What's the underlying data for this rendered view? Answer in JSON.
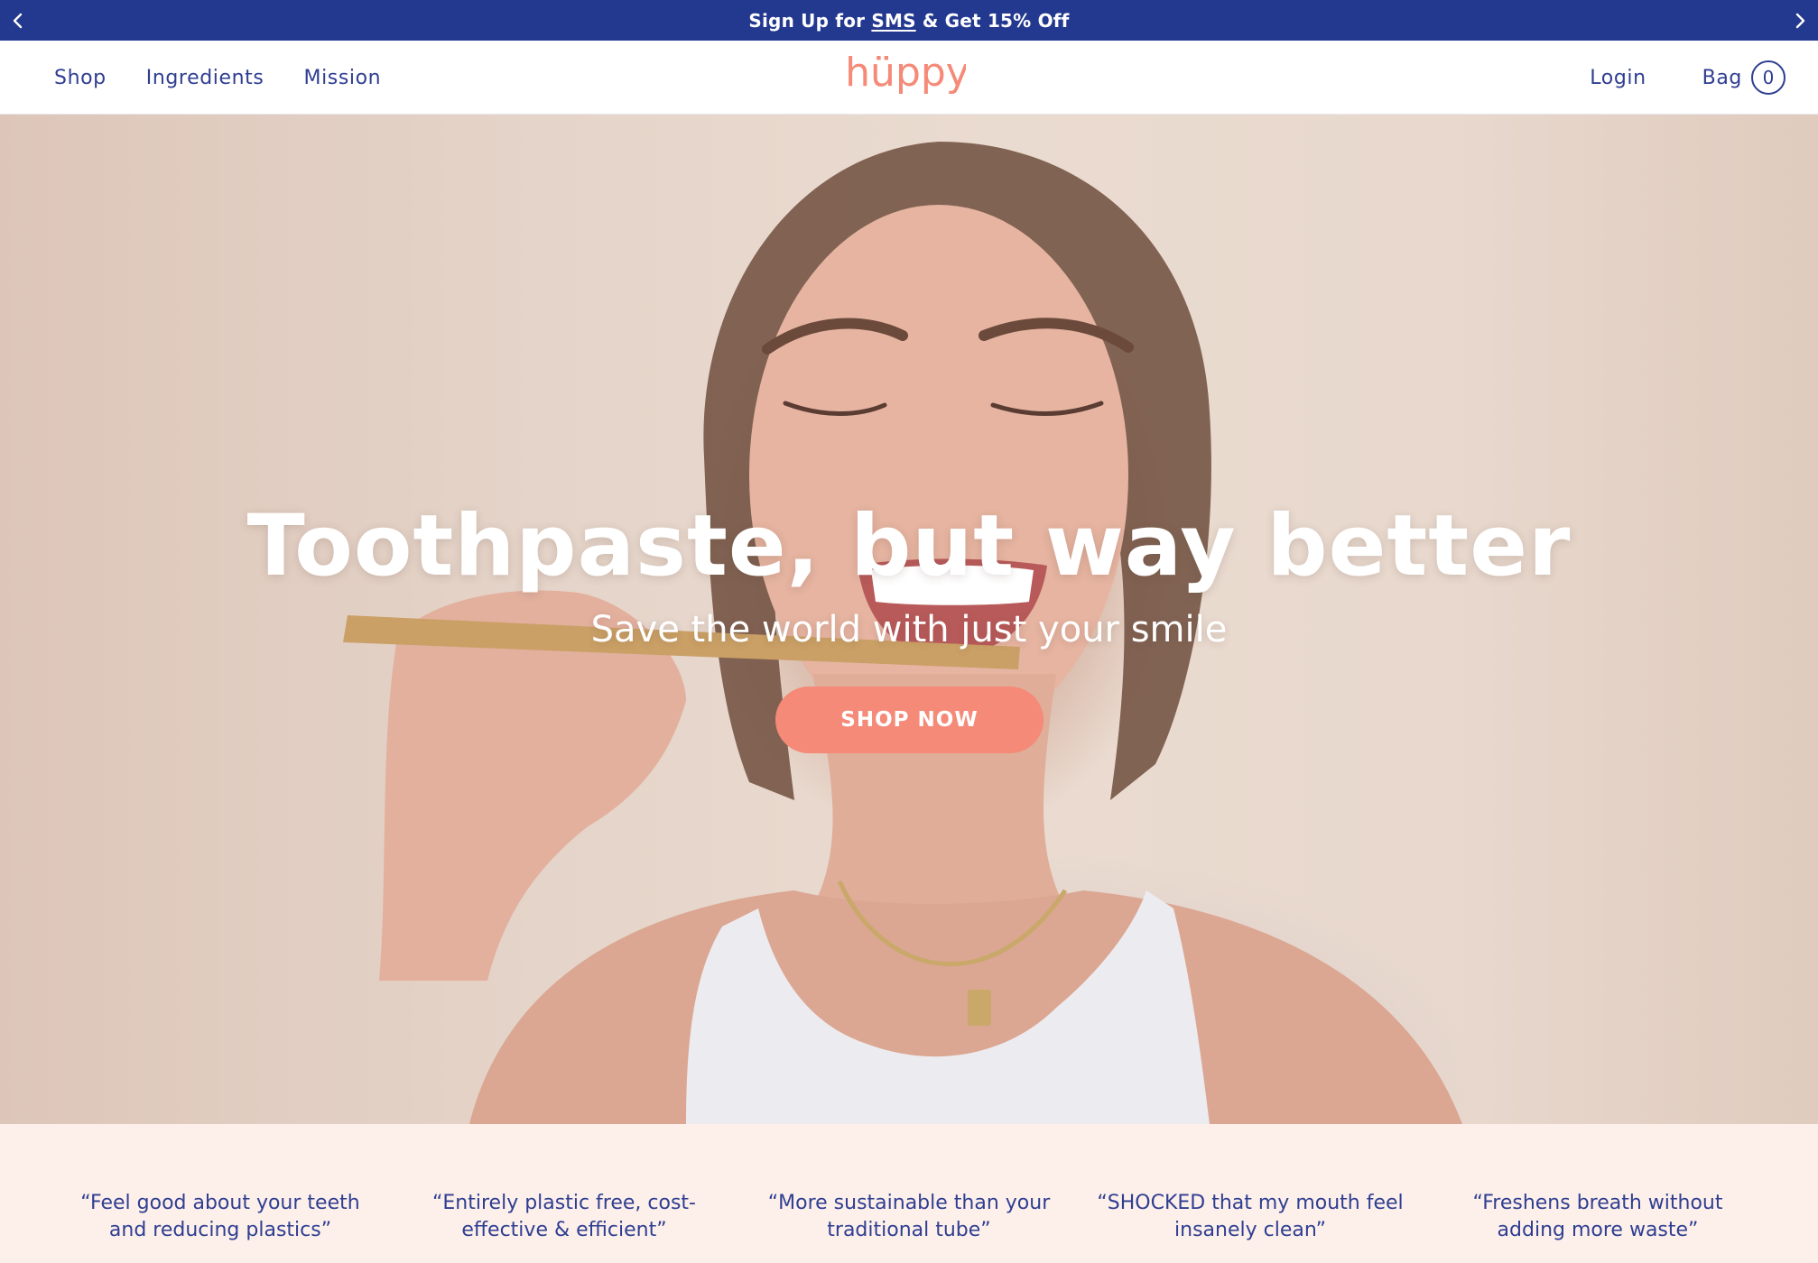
{
  "announcement": {
    "prefix": "Sign Up for ",
    "link": "SMS",
    "suffix": " & Get 15% Off",
    "prev_icon": "chevron-left-icon",
    "next_icon": "chevron-right-icon"
  },
  "nav": {
    "left": [
      "Shop",
      "Ingredients",
      "Mission"
    ],
    "logo": "hüppy",
    "login": "Login",
    "bag_label": "Bag",
    "bag_count": "0"
  },
  "hero": {
    "title": "Toothpaste, but way better",
    "subtitle": "Save the world with just your smile",
    "cta": "SHOP NOW"
  },
  "testimonials": [
    "“Feel good about your teeth and reducing plastics”",
    "“Entirely plastic free, cost-effective & efficient”",
    "“More sustainable than your traditional tube”",
    "“SHOCKED that my mouth feel insanely clean”",
    "“Freshens breath without adding more waste”"
  ],
  "colors": {
    "brand_navy": "#23388f",
    "accent_coral": "#f58a78",
    "testimonial_bg": "#fdf0eb"
  }
}
